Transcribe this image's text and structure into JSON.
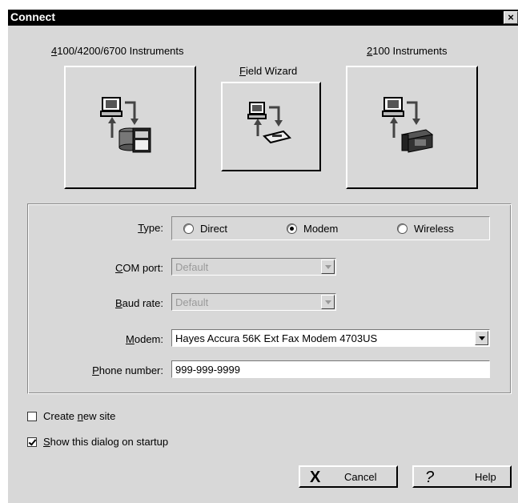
{
  "window": {
    "title": "Connect",
    "close_symbol": "×"
  },
  "instruments": {
    "group_a_label": {
      "key": "4",
      "rest": "100/4200/6700 Instruments"
    },
    "field_wizard_label": {
      "key": "F",
      "rest": "ield Wizard"
    },
    "group_b_label": {
      "key": "2",
      "rest": "100 Instruments"
    }
  },
  "connection": {
    "type_label": {
      "key": "T",
      "rest": "ype:"
    },
    "type_options": [
      {
        "label": "Direct",
        "selected": false
      },
      {
        "label": "Modem",
        "selected": true
      },
      {
        "label": "Wireless",
        "selected": false
      }
    ],
    "com_port": {
      "label_key": "C",
      "label_rest": "OM port:",
      "value": "Default",
      "enabled": false
    },
    "baud_rate": {
      "label_key": "B",
      "label_rest": "aud rate:",
      "value": "Default",
      "enabled": false
    },
    "modem": {
      "label_key": "M",
      "label_rest": "odem:",
      "value": "Hayes Accura 56K Ext Fax Modem 4703US",
      "enabled": true
    },
    "phone_number": {
      "label_key": "P",
      "label_rest": "hone number:",
      "value": "999-999-9999"
    }
  },
  "options": {
    "create_new_site": {
      "pre": "Create ",
      "key": "n",
      "post": "ew site",
      "checked": false
    },
    "show_on_startup": {
      "pre": "",
      "key": "S",
      "post": "how this dialog on startup",
      "checked": true
    }
  },
  "buttons": {
    "cancel": {
      "label": "Cancel",
      "icon": "X"
    },
    "help": {
      "label": "Help",
      "icon": "?"
    }
  },
  "colors": {
    "titlebar": "#000000",
    "dialog": "#d8d8d8"
  }
}
